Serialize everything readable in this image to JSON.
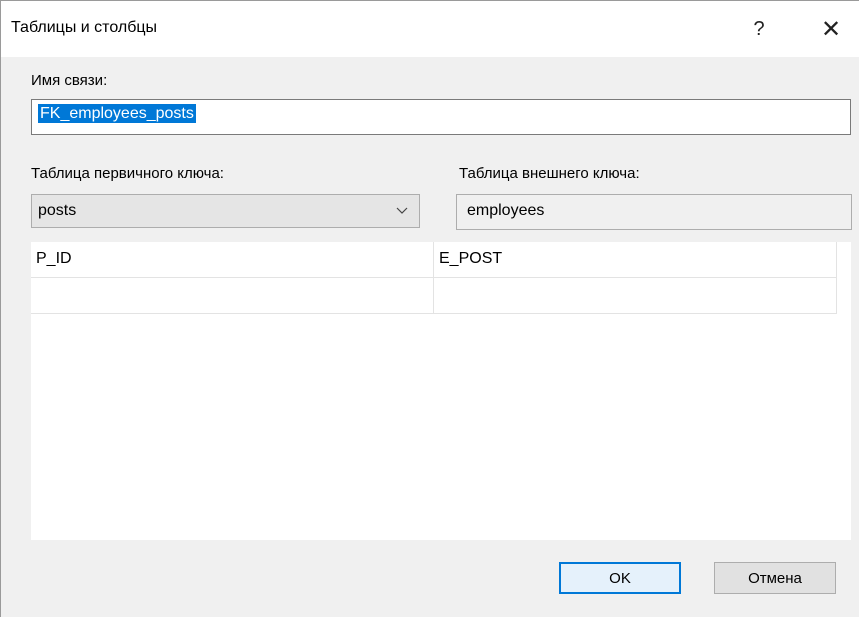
{
  "window": {
    "title": "Таблицы и столбцы",
    "help_glyph": "?",
    "close_glyph": "✕"
  },
  "relation": {
    "label": "Имя связи:",
    "value": "FK_employees_posts"
  },
  "primary_key_table": {
    "label": "Таблица первичного ключа:",
    "selected": "posts"
  },
  "foreign_key_table": {
    "label": "Таблица внешнего ключа:",
    "value": "employees"
  },
  "columns_grid": {
    "rows": [
      {
        "primary": "P_ID",
        "foreign": "E_POST"
      },
      {
        "primary": "",
        "foreign": ""
      }
    ]
  },
  "buttons": {
    "ok": "OK",
    "cancel": "Отмена"
  },
  "colors": {
    "selection": "#0078d7",
    "dialog_bg": "#f0f0f0"
  }
}
